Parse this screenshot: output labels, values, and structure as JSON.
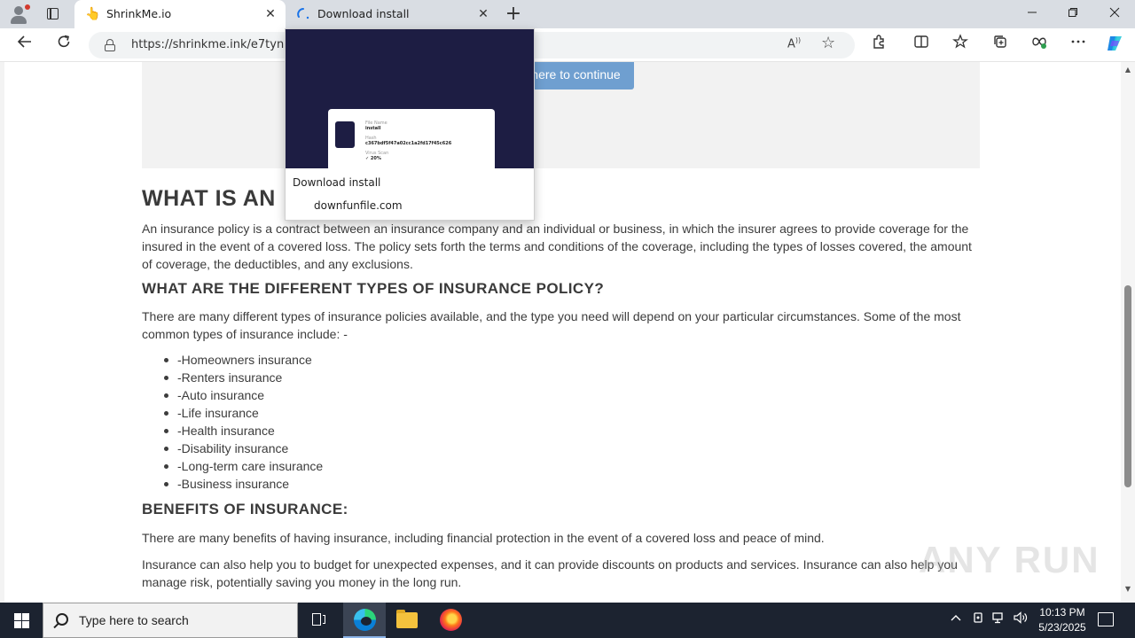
{
  "browser": {
    "tabs": [
      {
        "title": "ShrinkMe.io",
        "favicon": "hand-icon",
        "active": true
      },
      {
        "title": "Download install",
        "favicon": "loading-icon",
        "active": false
      }
    ],
    "url": "https://shrinkme.ink/e7tyn",
    "new_tab_symbol": "+",
    "close_symbol": "✕"
  },
  "preview": {
    "title": "Download install",
    "domain": "downfunfile.com",
    "card_lines": [
      "File Name",
      "install",
      "Hash",
      "c367bdf5f47a02cc1a2fd17f45c626",
      "Virus Scan",
      "✓ 20%"
    ]
  },
  "page": {
    "continue_button": "here to continue",
    "h1": "WHAT IS AN",
    "p1": "An insurance policy is a contract between an insurance company and an individual or business, in which the insurer agrees to provide coverage for the insured in the event of a covered loss. The policy sets forth the terms and conditions of the coverage, including the types of losses covered, the amount of coverage, the deductibles, and any exclusions.",
    "h2_types": "WHAT ARE THE DIFFERENT TYPES OF INSURANCE POLICY?",
    "p_types": "There are many different types of insurance policies available, and the type you need will depend on your particular circumstances. Some of the most common types of insurance include: -",
    "list": [
      "-Homeowners insurance",
      "-Renters insurance",
      "-Auto insurance",
      "-Life insurance",
      "-Health insurance",
      "-Disability insurance",
      "-Long-term care insurance",
      "-Business insurance"
    ],
    "h2_benefits": "BENEFITS OF INSURANCE:",
    "p_benefits1": "There are many benefits of having insurance, including financial protection in the event of a covered loss and peace of mind.",
    "p_benefits2": "Insurance can also help you to budget for unexpected expenses, and it can provide discounts on products and services. Insurance can also help you manage risk, potentially saving you money in the long run.",
    "watermark": "ANY RUN"
  },
  "taskbar": {
    "search_placeholder": "Type here to search",
    "time": "10:13 PM",
    "date": "5/23/2025"
  }
}
